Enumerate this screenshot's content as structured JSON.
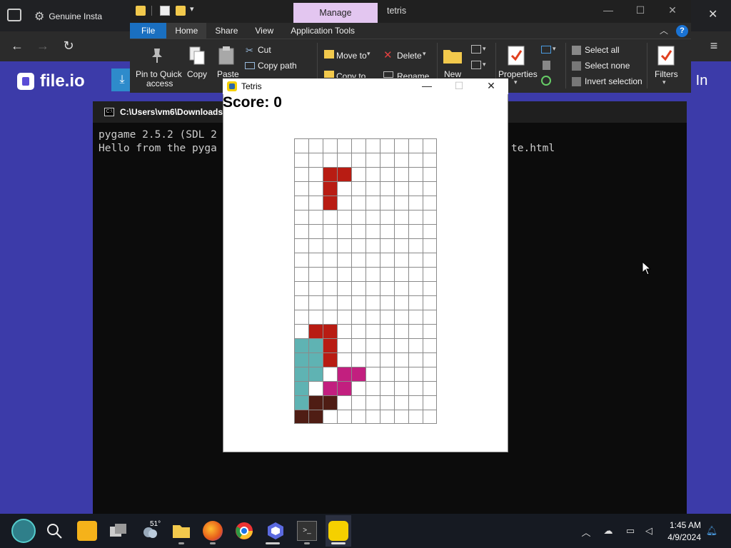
{
  "browser": {
    "tab_title": "Genuine Insta",
    "site_name": "file.io",
    "login_text": "g In"
  },
  "terminal": {
    "title": "C:\\Users\\vm6\\Downloads",
    "lines": [
      "pygame 2.5.2 (SDL 2",
      "Hello from the pyga"
    ],
    "line_right": "te.html"
  },
  "explorer": {
    "manage_tab": "Manage",
    "title": "tetris",
    "tabs": [
      "File",
      "Home",
      "Share",
      "View",
      "Application Tools"
    ],
    "help": "?",
    "clipboard": {
      "pin_label_1": "Pin to Quick",
      "pin_label_2": "access",
      "copy_label": "Copy",
      "paste_label": "Paste",
      "cut_label": "Cut",
      "copy_path_label": "Copy path"
    },
    "organize": {
      "move_to": "Move to",
      "copy_to": "Copy to",
      "delete": "Delete",
      "rename": "Rename"
    },
    "new_label": "New",
    "properties_label": "Properties",
    "select": {
      "select_all": "Select all",
      "select_none": "Select none",
      "invert": "Invert selection"
    },
    "filters_label": "Filters"
  },
  "tetris": {
    "window_title": "Tetris",
    "score_label": "Score: 0",
    "board": {
      "cols": 10,
      "rows": 20,
      "cells": [
        {
          "r": 2,
          "c": 2,
          "color": "#b81c13"
        },
        {
          "r": 2,
          "c": 3,
          "color": "#b81c13"
        },
        {
          "r": 3,
          "c": 2,
          "color": "#b81c13"
        },
        {
          "r": 4,
          "c": 2,
          "color": "#b81c13"
        },
        {
          "r": 13,
          "c": 1,
          "color": "#b81c13"
        },
        {
          "r": 13,
          "c": 2,
          "color": "#b81c13"
        },
        {
          "r": 14,
          "c": 2,
          "color": "#b81c13"
        },
        {
          "r": 15,
          "c": 2,
          "color": "#b81c13"
        },
        {
          "r": 14,
          "c": 0,
          "color": "#5fb3b3"
        },
        {
          "r": 14,
          "c": 1,
          "color": "#5fb3b3"
        },
        {
          "r": 15,
          "c": 0,
          "color": "#5fb3b3"
        },
        {
          "r": 15,
          "c": 1,
          "color": "#5fb3b3"
        },
        {
          "r": 16,
          "c": 0,
          "color": "#5fb3b3"
        },
        {
          "r": 16,
          "c": 1,
          "color": "#5fb3b3"
        },
        {
          "r": 17,
          "c": 0,
          "color": "#5fb3b3"
        },
        {
          "r": 18,
          "c": 0,
          "color": "#5fb3b3"
        },
        {
          "r": 16,
          "c": 3,
          "color": "#c21f7f"
        },
        {
          "r": 16,
          "c": 4,
          "color": "#c21f7f"
        },
        {
          "r": 17,
          "c": 2,
          "color": "#c21f7f"
        },
        {
          "r": 17,
          "c": 3,
          "color": "#c21f7f"
        },
        {
          "r": 18,
          "c": 1,
          "color": "#4f1d14"
        },
        {
          "r": 18,
          "c": 2,
          "color": "#4f1d14"
        },
        {
          "r": 19,
          "c": 0,
          "color": "#4f1d14"
        },
        {
          "r": 19,
          "c": 1,
          "color": "#4f1d14"
        }
      ]
    }
  },
  "taskbar": {
    "weather_temp": "51°",
    "time": "1:45 AM",
    "date": "4/9/2024",
    "apps": [
      "world-icon",
      "search-icon",
      "pre-app-icon",
      "task-view-icon",
      "weather-icon",
      "file-explorer-icon",
      "firefox-icon",
      "chrome-icon",
      "app-icon",
      "terminal-icon",
      "python-icon"
    ]
  }
}
